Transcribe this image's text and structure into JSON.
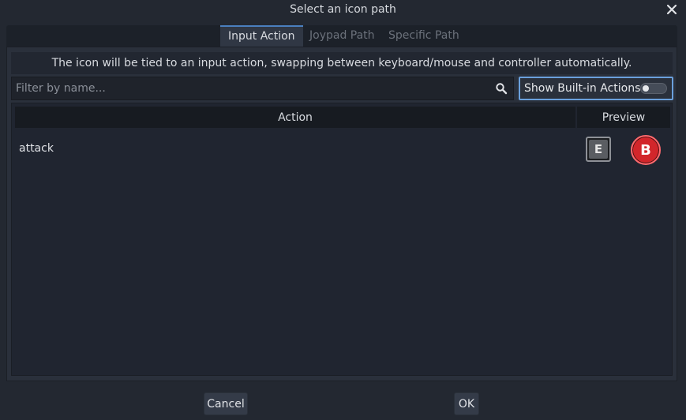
{
  "dialog": {
    "title": "Select an icon path"
  },
  "tabs": [
    {
      "label": "Input Action",
      "active": true
    },
    {
      "label": "Joypad Path",
      "active": false
    },
    {
      "label": "Specific Path",
      "active": false
    }
  ],
  "hint": "The icon will be tied to an input action, swapping between keyboard/mouse and controller automatically.",
  "filter": {
    "placeholder": "Filter by name...",
    "value": ""
  },
  "builtin_toggle": {
    "label": "Show Built-in Actions",
    "checked": false
  },
  "table": {
    "columns": [
      "Action",
      "Preview"
    ],
    "rows": [
      {
        "action": "attack",
        "keyboard_glyph": "E",
        "controller_glyph": "B"
      }
    ]
  },
  "buttons": {
    "cancel": "Cancel",
    "ok": "OK"
  },
  "colors": {
    "accent": "#4a7fbf",
    "controller_b": "#d2262b"
  },
  "icons": {
    "close": "close-icon",
    "search": "search-icon"
  }
}
